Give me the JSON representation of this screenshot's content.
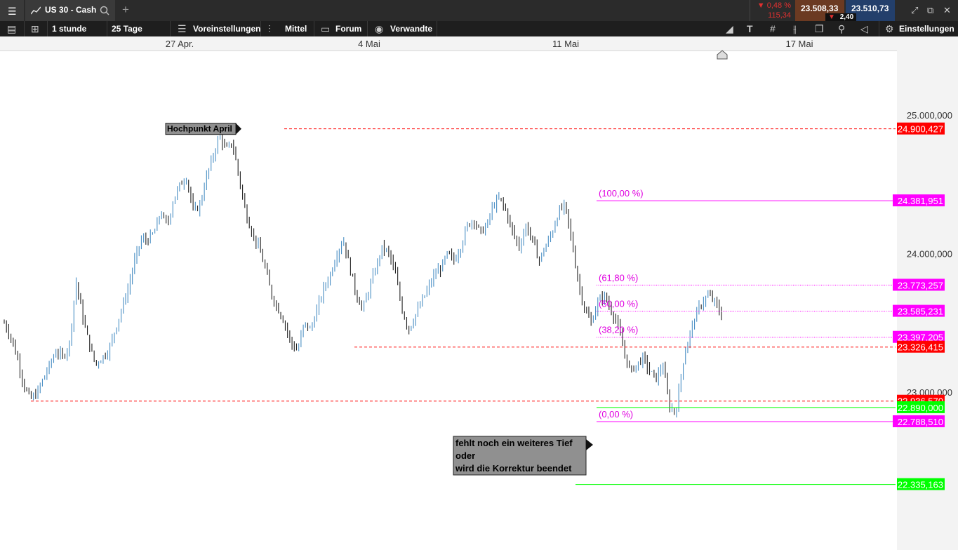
{
  "header": {
    "menu_icon": "hamburger-icon",
    "tab_title": "US 30 - Cash",
    "add_tab": "+",
    "change_pct": "▼ 0,48 %",
    "change_abs": "115,34",
    "bid": "23.508,33",
    "ask": "23.510,73",
    "spread": "2,40",
    "spread_arrow": "▼",
    "colors": {
      "down": "#e03030",
      "bid_bg": "#8a3a1e",
      "ask_bg": "#1f4a86"
    }
  },
  "toolbar": {
    "interval": "1 stunde",
    "range": "25 Tage",
    "presets": "Voreinstellungen",
    "indicator": "Mittel",
    "forum": "Forum",
    "related": "Verwandte",
    "settings": "Einstellungen"
  },
  "chart_data": {
    "type": "ohlc",
    "time_axis": {
      "labels": [
        "27 Apr.",
        "4 Mai",
        "11 Mai",
        "17 Mai"
      ]
    },
    "y_axis": {
      "ticks": [
        "25.000,000",
        "24.000,000",
        "23.000,000"
      ],
      "ylim": [
        22100,
        25480
      ]
    },
    "price_path": [
      [
        23500,
        23400,
        23250,
        23050,
        22950,
        22990,
        23100,
        23200,
        23300,
        23250,
        23350,
        23800,
        23550,
        23350,
        23200,
        23250,
        23300,
        23450,
        23600,
        23750,
        23950,
        24100,
        24100,
        24150,
        24300,
        24200,
        24400,
        24500,
        24550,
        24300,
        24350,
        24550,
        24700,
        24850,
        24750,
        24800,
        24550,
        24300,
        24150,
        24050,
        23900,
        23700,
        23600,
        23500,
        23350,
        23300,
        23500,
        23450,
        23600,
        23750,
        23850,
        24000,
        24100,
        23900,
        23700,
        23600,
        23750,
        23900,
        24050,
        24000,
        23850,
        23600,
        23450,
        23550,
        23650,
        23750,
        23850,
        23900,
        24000,
        23950,
        24050,
        24200,
        24250,
        24150,
        24200,
        24350,
        24400,
        24300,
        24150,
        24050,
        24200,
        24100,
        23950,
        24050,
        24150,
        24300,
        24350,
        24100,
        23800,
        23600,
        23500,
        23650,
        23700,
        23600,
        23500,
        23300,
        23150,
        23200,
        23250,
        23150,
        23100,
        23200,
        22900,
        22850,
        23200,
        23400,
        23550,
        23650,
        23700,
        23650,
        23550
      ]
    ],
    "horizontal_levels": [
      {
        "label": "24.900,427",
        "kind": "resistance",
        "color": "#ff0000"
      },
      {
        "label": "24.381,951",
        "kind": "fib",
        "ratio": "(100,00 %)",
        "color": "#ff00ff"
      },
      {
        "label": "23.773,257",
        "kind": "fib",
        "ratio": "(61,80 %)",
        "color": "#ff00ff"
      },
      {
        "label": "23.585,231",
        "kind": "fib",
        "ratio": "(50,00 %)",
        "color": "#ff00ff"
      },
      {
        "label": "23.397,205",
        "kind": "fib",
        "ratio": "(38,20 %)",
        "color": "#ff00ff"
      },
      {
        "label": "23.326,415",
        "kind": "support",
        "color": "#ff0000"
      },
      {
        "label": "22.936,570",
        "kind": "support",
        "color": "#ff0000"
      },
      {
        "label": "22.890,000",
        "kind": "current",
        "color": "#00ff00"
      },
      {
        "label": "22.788,510",
        "kind": "fib",
        "ratio": "(0,00 %)",
        "color": "#ff00ff"
      },
      {
        "label": "22.335,163",
        "kind": "target",
        "color": "#00ff00"
      }
    ],
    "annotations": [
      {
        "text": "Hochpunkt April",
        "target_price": "24.900,427"
      },
      {
        "text_lines": [
          "fehlt noch ein weiteres Tief",
          "oder",
          "wird die Korrektur beendet"
        ]
      }
    ]
  }
}
